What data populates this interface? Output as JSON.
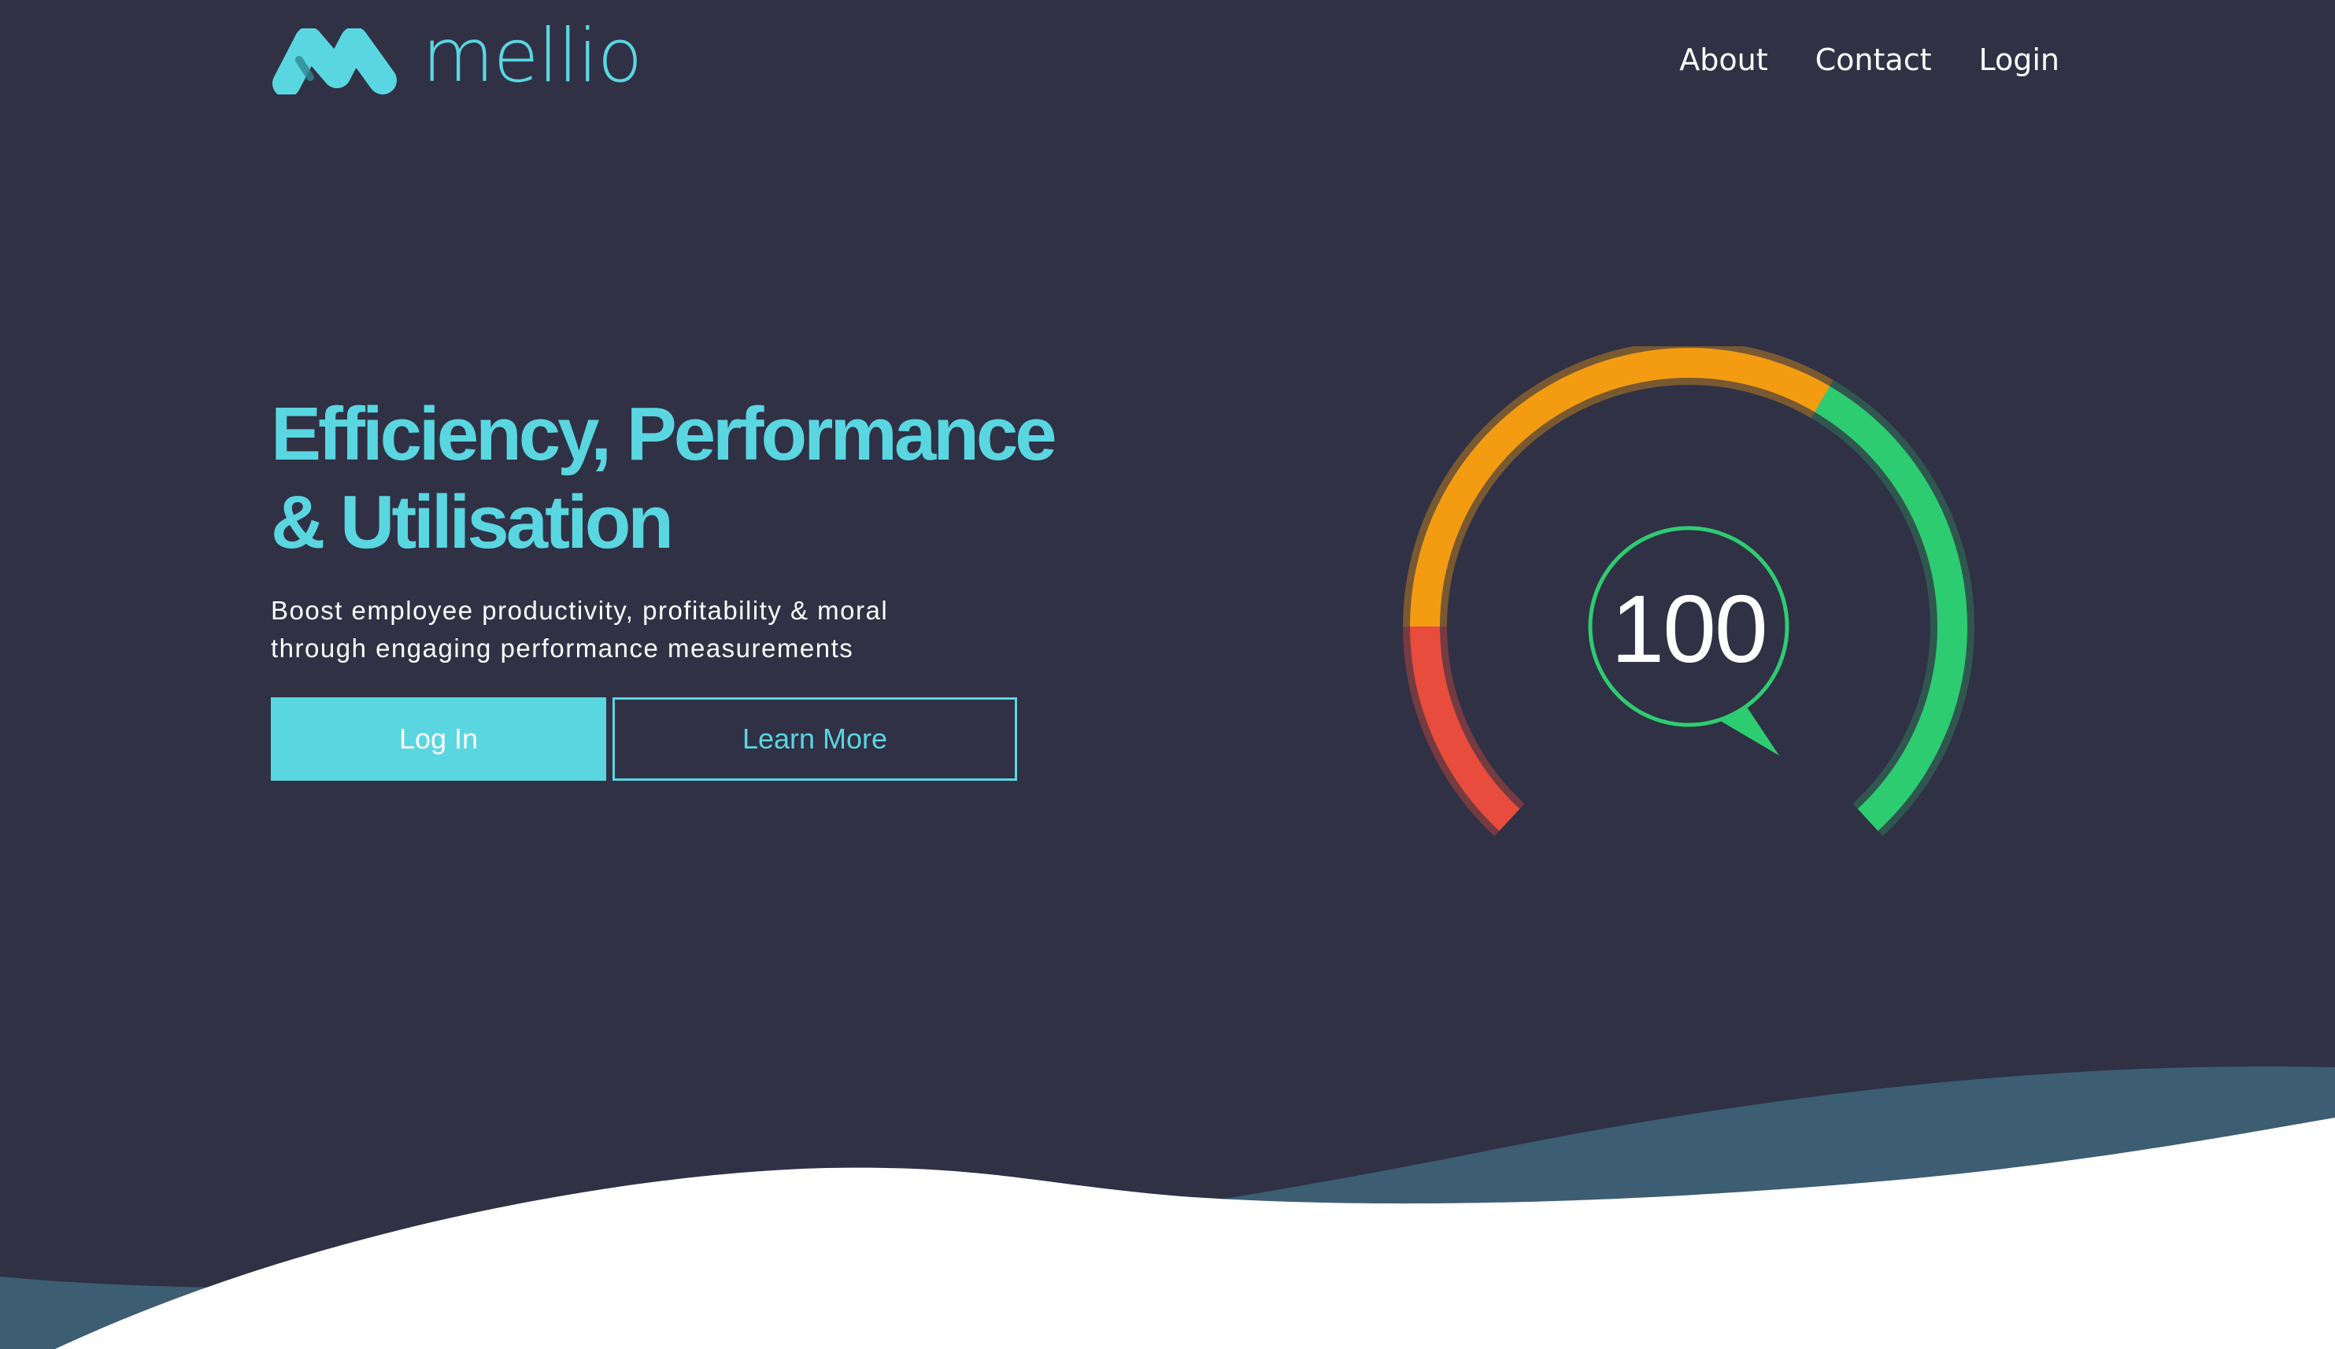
{
  "brand": {
    "name": "mellio",
    "accent_color": "#5ad6e1",
    "background_color": "#303145"
  },
  "nav": {
    "items": [
      {
        "label": "About"
      },
      {
        "label": "Contact"
      },
      {
        "label": "Login"
      }
    ]
  },
  "hero": {
    "headline_line1": "Efficiency, Performance",
    "headline_line2": "& Utilisation",
    "subtitle_line1": "Boost employee productivity, profitability & moral",
    "subtitle_line2": "through engaging performance measurements",
    "primary_button": "Log In",
    "secondary_button": "Learn More"
  },
  "gauge": {
    "value": "100",
    "segment_colors": {
      "low": "#e74c3c",
      "mid": "#f39c12",
      "high": "#2ecc71"
    }
  }
}
